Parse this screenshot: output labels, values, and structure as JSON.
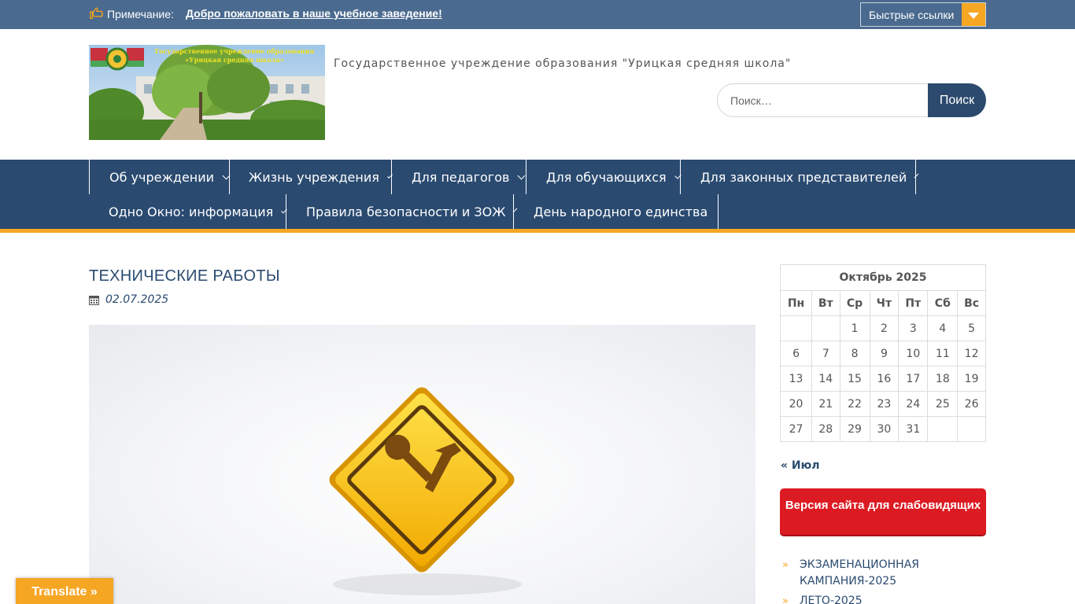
{
  "topbar": {
    "note_label": "Примечание:",
    "note_link": "Добро пожаловать в наше учебное заведение!",
    "quick_links_label": "Быстрые ссылки"
  },
  "header": {
    "logo_caption_line1": "Государственное учреждение образования",
    "logo_caption_line2": "«Урицкая средняя школа»",
    "tagline": "Государственное учреждение образования \"Урицкая средняя школа\"",
    "search_placeholder": "Поиск…",
    "search_button": "Поиск"
  },
  "nav": {
    "items": [
      {
        "label": "Об учреждении",
        "has_submenu": true
      },
      {
        "label": "Жизнь учреждения",
        "has_submenu": true
      },
      {
        "label": "Для педагогов",
        "has_submenu": true
      },
      {
        "label": "Для обучающихся",
        "has_submenu": true
      },
      {
        "label": "Для законных представителей",
        "has_submenu": true
      },
      {
        "label": "Одно Окно: информация",
        "has_submenu": true
      },
      {
        "label": "Правила безопасности и ЗОЖ",
        "has_submenu": true
      },
      {
        "label": "День народного единства",
        "has_submenu": false
      }
    ]
  },
  "post": {
    "title": "ТЕХНИЧЕСКИЕ РАБОТЫ",
    "date": "02.07.2025"
  },
  "calendar": {
    "caption": "Октябрь 2025",
    "weekdays": [
      "Пн",
      "Вт",
      "Ср",
      "Чт",
      "Пт",
      "Сб",
      "Вс"
    ],
    "weeks": [
      [
        "",
        "",
        "1",
        "2",
        "3",
        "4",
        "5"
      ],
      [
        "6",
        "7",
        "8",
        "9",
        "10",
        "11",
        "12"
      ],
      [
        "13",
        "14",
        "15",
        "16",
        "17",
        "18",
        "19"
      ],
      [
        "20",
        "21",
        "22",
        "23",
        "24",
        "25",
        "26"
      ],
      [
        "27",
        "28",
        "29",
        "30",
        "31",
        "",
        ""
      ]
    ],
    "prev_link": "« Июл"
  },
  "sidebar": {
    "vision_button": "Версия сайта для слабовидящих",
    "links": [
      "ЭКЗАМЕНАЦИОННАЯ КАМПАНИЯ-2025",
      "ЛЕТО-2025"
    ]
  },
  "translate_button": "Translate »",
  "colors": {
    "topbar": "#4a6a8f",
    "nav": "#2a4a70",
    "accent": "#f5a623",
    "vision_button": "#dc1a22"
  }
}
